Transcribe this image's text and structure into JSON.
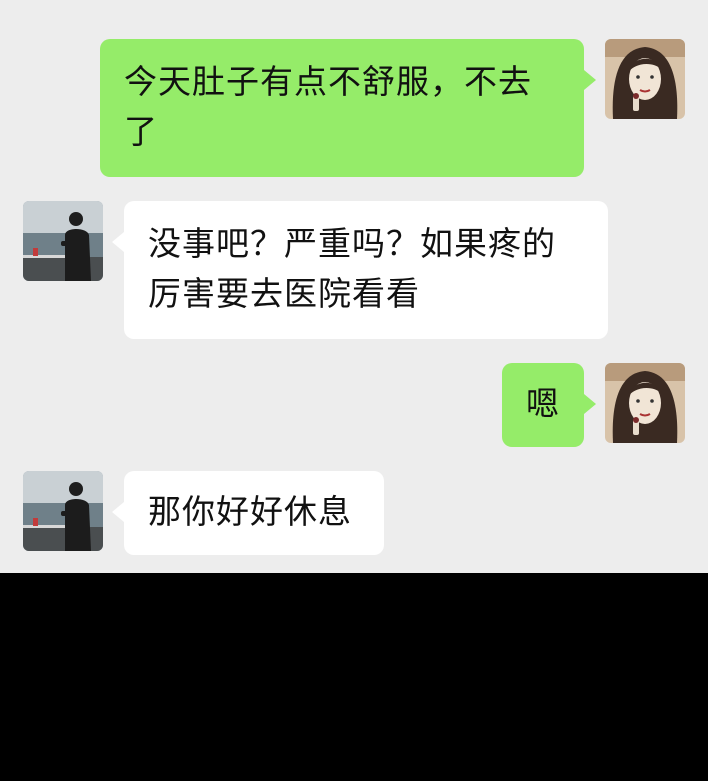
{
  "messages": [
    {
      "side": "sent",
      "sender": "self",
      "text": "今天肚子有点不舒服，不去了"
    },
    {
      "side": "received",
      "sender": "contact",
      "text": "没事吧？严重吗？如果疼的厉害要去医院看看"
    },
    {
      "side": "sent",
      "sender": "self",
      "text": "嗯"
    },
    {
      "side": "received",
      "sender": "contact",
      "text": "那你好好休息"
    }
  ],
  "colors": {
    "background": "#ededed",
    "sent_bubble": "#95ec69",
    "received_bubble": "#ffffff",
    "text": "#111111"
  },
  "avatars": {
    "self": "illustrated-woman-avatar",
    "contact": "man-at-seaside-avatar"
  }
}
